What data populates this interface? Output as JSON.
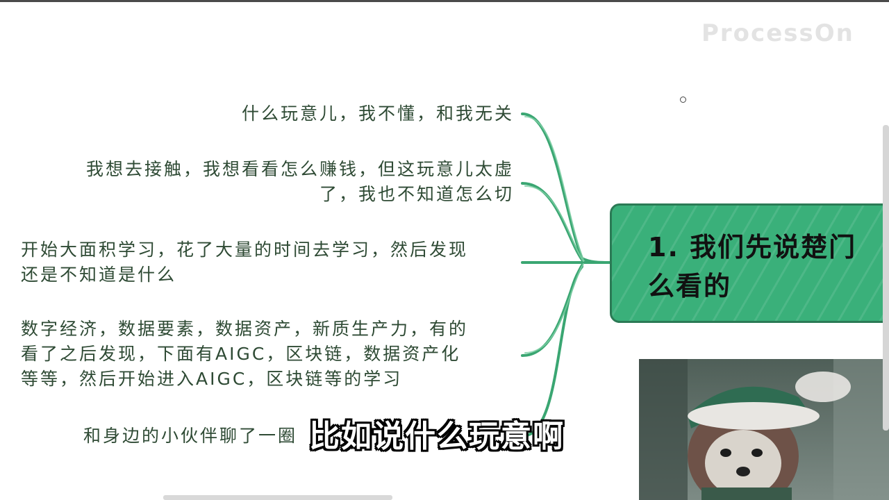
{
  "watermark": {
    "text": "ProcessOn"
  },
  "mindmap": {
    "main_node": {
      "title": "1. 我们先说楚门\n么看的"
    },
    "branches": [
      {
        "text": "什么玩意儿，我不懂，和我无关"
      },
      {
        "text": "我想去接触，我想看看怎么赚钱，但这玩意儿太虚\n了，我也不知道怎么切"
      },
      {
        "text": "开始大面积学习，花了大量的时间去学习，然后发现\n还是不知道是什么"
      },
      {
        "text": "数字经济，数据要素，数据资产，新质生产力，有的\n看了之后发现，下面有AIGC，区块链，数据资产化\n等等，然后开始进入AIGC，区块链等的学习"
      },
      {
        "text": "和身边的小伙伴聊了一圈"
      }
    ],
    "colors": {
      "node_fill": "#3ab07a",
      "connector": "#3aa672",
      "branch_text": "#2e4a34"
    }
  },
  "video": {
    "subtitle": "比如说什么玩意啊"
  }
}
